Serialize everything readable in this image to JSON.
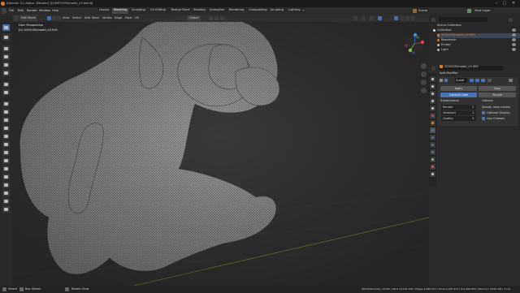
{
  "title_bar": {
    "title": "[Blender 3.1 Alpha - Blender] [D:\\REF\\005\\model_v3.blend]",
    "minimize": "–",
    "maximize": "□",
    "close": "✕"
  },
  "top_bar": {
    "editor_mode": "Edit Mode",
    "menus": [
      "File",
      "Edit",
      "Render",
      "Window",
      "Help"
    ],
    "workspaces": [
      "Layout",
      "Modeling",
      "Sculpting",
      "UV Editing",
      "Texture Paint",
      "Shading",
      "Animation",
      "Rendering",
      "Compositing",
      "Scripting",
      "Lighting"
    ],
    "active_workspace": "Modeling",
    "scene": "Scene",
    "view_layer": "View Layer"
  },
  "viewport": {
    "header_items": [
      "View",
      "Select",
      "Add",
      "Mesh",
      "Vertex",
      "Edge",
      "Face",
      "UV"
    ],
    "transform_orientation": "Global",
    "overlay_line1": "User Perspective",
    "overlay_line2": "(0) 005\\000\\model_v3.000"
  },
  "outliner": {
    "header": "Scene Collection",
    "rows": [
      {
        "name": "Collection",
        "icon_color": "#e6e6e6"
      },
      {
        "name": "20V\\000\\model_v3.000",
        "icon_color": "#e07b2a"
      },
      {
        "name": "Basemesh",
        "icon_color": "#e07b2a"
      },
      {
        "name": "Empty",
        "icon_color": "#b5b5b5"
      },
      {
        "name": "Light",
        "icon_color": "#b5b5b5"
      }
    ]
  },
  "properties": {
    "header": "20V\\000\\model_v3.000",
    "add_modifier": "Add Modifier",
    "modifier_name": "Subdi",
    "apply": "Apply",
    "copy": "Copy",
    "method_a": "Catmull-Clark",
    "method_b": "Simple",
    "subdivisions_label": "Subdivisions",
    "options_label": "Options",
    "rows": [
      {
        "label": "Render",
        "value": "2"
      },
      {
        "label": "Viewport",
        "value": "1"
      },
      {
        "label": "Quality",
        "value": "3"
      }
    ],
    "options": [
      "Smooth, keep corners",
      "Optimal Display",
      "Use Creases"
    ]
  },
  "status_bar": {
    "left": "Select",
    "middle_a": "Box Select",
    "middle_b": "Rotate View",
    "stats": "20V\\000\\model_v3.000 | Verts 23,031,052 | Edges 4,985,423 | Faces 6,007,413 | Tris 296,650 | Memory: 13.60 GiB | 3.1.0"
  },
  "colors": {
    "accent": "#4772b3",
    "selection_orange": "#e07b2a",
    "viewport_bg": "#393939",
    "panel_bg": "#2b2b2b"
  }
}
